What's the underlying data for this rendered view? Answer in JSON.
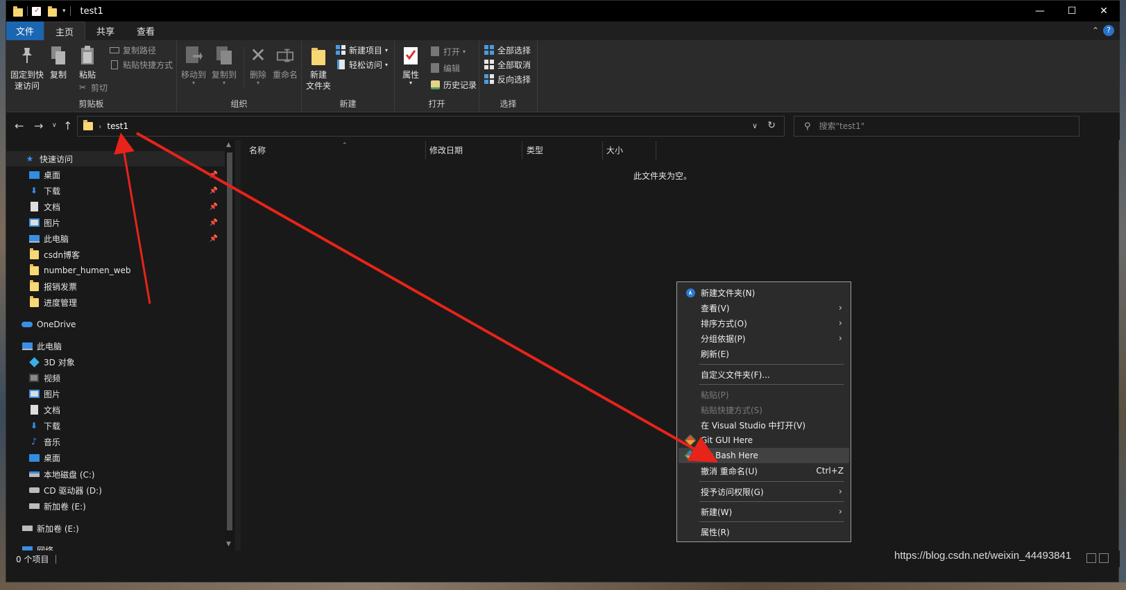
{
  "window": {
    "title": "test1",
    "controls": {
      "minimize": "—",
      "maximize": "☐",
      "close": "✕"
    }
  },
  "tabs": [
    {
      "label": "文件"
    },
    {
      "label": "主页"
    },
    {
      "label": "共享"
    },
    {
      "label": "查看"
    }
  ],
  "ribbon": {
    "clipboard": {
      "group_label": "剪贴板",
      "pin_label_1": "固定到快",
      "pin_label_2": "速访问",
      "copy": "复制",
      "paste": "粘贴",
      "copy_path": "复制路径",
      "paste_shortcut": "粘贴快捷方式",
      "cut": "剪切"
    },
    "organize": {
      "group_label": "组织",
      "move_to": "移动到",
      "copy_to": "复制到",
      "delete": "删除",
      "rename": "重命名"
    },
    "new": {
      "group_label": "新建",
      "new_folder_1": "新建",
      "new_folder_2": "文件夹",
      "new_item": "新建项目",
      "easy_access": "轻松访问"
    },
    "open": {
      "group_label": "打开",
      "properties": "属性",
      "open": "打开",
      "edit": "编辑",
      "history": "历史记录"
    },
    "select": {
      "group_label": "选择",
      "select_all": "全部选择",
      "select_none": "全部取消",
      "invert": "反向选择"
    }
  },
  "address": {
    "crumb": "test1",
    "search_placeholder": "搜索\"test1\""
  },
  "navpane": {
    "quick_access": "快速访问",
    "quick_items": [
      {
        "label": "桌面"
      },
      {
        "label": "下载"
      },
      {
        "label": "文档"
      },
      {
        "label": "图片"
      },
      {
        "label": "此电脑"
      },
      {
        "label": "csdn博客"
      },
      {
        "label": "number_humen_web"
      },
      {
        "label": "报销发票"
      },
      {
        "label": "进度管理"
      }
    ],
    "onedrive": "OneDrive",
    "this_pc": "此电脑",
    "pc_items": [
      {
        "label": "3D 对象"
      },
      {
        "label": "视频"
      },
      {
        "label": "图片"
      },
      {
        "label": "文档"
      },
      {
        "label": "下载"
      },
      {
        "label": "音乐"
      },
      {
        "label": "桌面"
      },
      {
        "label": "本地磁盘 (C:)"
      },
      {
        "label": "CD 驱动器 (D:)"
      },
      {
        "label": "新加卷 (E:)"
      }
    ],
    "volume_e": "新加卷 (E:)",
    "network": "网络"
  },
  "columns": {
    "name": "名称",
    "modified": "修改日期",
    "type": "类型",
    "size": "大小"
  },
  "content": {
    "empty_message": "此文件夹为空。"
  },
  "status": {
    "item_count": "0 个项目",
    "separator": "|"
  },
  "watermark": "https://blog.csdn.net/weixin_44493841",
  "context_menu": {
    "items": [
      {
        "label": "新建文件夹(N)"
      },
      {
        "label": "查看(V)"
      },
      {
        "label": "排序方式(O)"
      },
      {
        "label": "分组依据(P)"
      },
      {
        "label": "刷新(E)"
      },
      {
        "label": "自定义文件夹(F)..."
      },
      {
        "label": "粘贴(P)"
      },
      {
        "label": "粘贴快捷方式(S)"
      },
      {
        "label": "在 Visual Studio 中打开(V)"
      },
      {
        "label": "Git GUI Here"
      },
      {
        "label": "Git Bash Here"
      },
      {
        "label": "撤消 重命名(U)",
        "shortcut": "Ctrl+Z"
      },
      {
        "label": "授予访问权限(G)"
      },
      {
        "label": "新建(W)"
      },
      {
        "label": "属性(R)"
      }
    ]
  },
  "colors": {
    "accent": "#1a66b0",
    "annotation": "#e8231a"
  }
}
